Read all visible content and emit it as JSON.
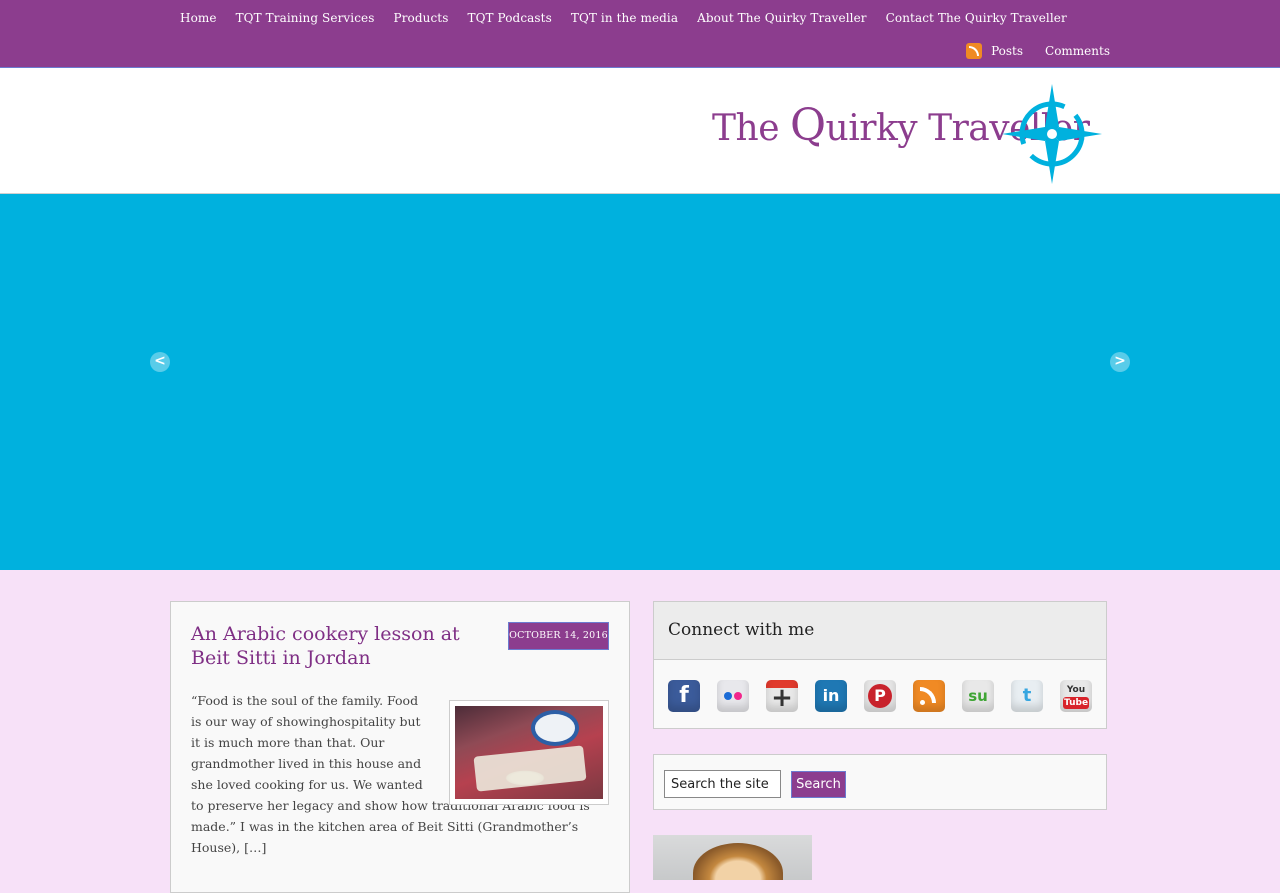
{
  "nav": {
    "items": [
      {
        "label": "Home"
      },
      {
        "label": "TQT Training Services"
      },
      {
        "label": "Products"
      },
      {
        "label": "TQT Podcasts"
      },
      {
        "label": "TQT in the media"
      },
      {
        "label": "About The Quirky Traveller"
      },
      {
        "label": "Contact The Quirky Traveller"
      }
    ],
    "feeds": {
      "posts": "Posts",
      "comments": "Comments"
    }
  },
  "header": {
    "logo_the": "The",
    "logo_q": "Q",
    "logo_uirky": "uirky",
    "logo_traveller": "Traveller",
    "accent_color": "#00b1de",
    "brand_color": "#8c3d8e"
  },
  "slider": {
    "prev_glyph": "<",
    "next_glyph": ">"
  },
  "post": {
    "title": "An Arabic cookery lesson at Beit Sitti in Jordan",
    "date": "OCTOBER 14, 2016",
    "excerpt": "“Food is the soul of the family. Food is our way of showinghospitality but it is much more than that. Our grandmother lived in this house and she loved cooking for us. We wanted to preserve her legacy and show how traditional Arabic food is made.” I was in the kitchen area of Beit Sitti (Grandmother’s House), […]"
  },
  "connect": {
    "title": "Connect with me",
    "icons": [
      {
        "name": "facebook-icon",
        "glyph": "f"
      },
      {
        "name": "flickr-icon",
        "glyph": ""
      },
      {
        "name": "google-plus-icon",
        "glyph": "+"
      },
      {
        "name": "linkedin-icon",
        "glyph": "in"
      },
      {
        "name": "pinterest-icon",
        "glyph": "P"
      },
      {
        "name": "rss-icon",
        "glyph": ""
      },
      {
        "name": "stumbleupon-icon",
        "glyph": "su"
      },
      {
        "name": "twitter-icon",
        "glyph": "t"
      },
      {
        "name": "youtube-icon",
        "glyph_you": "You",
        "glyph_tube": "Tube"
      }
    ]
  },
  "search": {
    "value": "Search the site",
    "button": "Search"
  }
}
